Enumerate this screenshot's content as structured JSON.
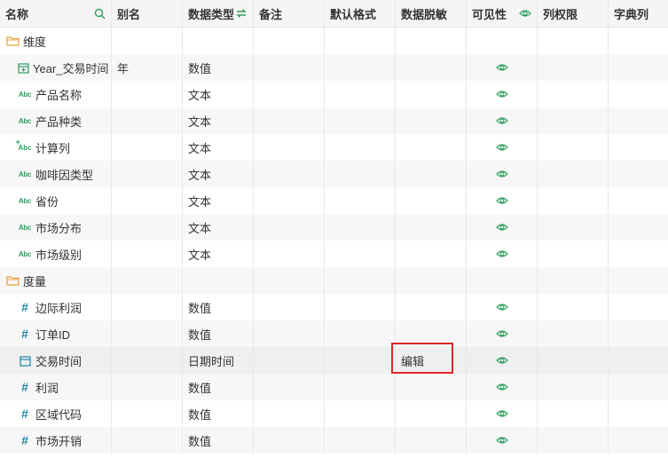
{
  "header": {
    "name": "名称",
    "alias": "别名",
    "data_type": "数据类型",
    "remark": "备注",
    "default_format": "默认格式",
    "data_masking": "数据脱敏",
    "visibility": "可见性",
    "column_permission": "列权限",
    "dictionary": "字典列"
  },
  "colors": {
    "accent_green": "#2e9e5b",
    "measure_blue": "#1d87a8",
    "folder_orange": "#e8a33d",
    "highlight_red": "#d9262b"
  },
  "rows": [
    {
      "kind": "folder",
      "icon": "folder-icon",
      "name": "维度",
      "alias": "",
      "type": "",
      "visible": false
    },
    {
      "kind": "field",
      "icon": "date-dim-icon",
      "name": "Year_交易时间",
      "alias": "年",
      "type": "数值",
      "visible": true
    },
    {
      "kind": "field",
      "icon": "text-abc-icon",
      "name": "产品名称",
      "alias": "",
      "type": "文本",
      "visible": true
    },
    {
      "kind": "field",
      "icon": "text-abc-icon",
      "name": "产品种类",
      "alias": "",
      "type": "文本",
      "visible": true
    },
    {
      "kind": "field",
      "icon": "calc-field-icon",
      "name": "计算列",
      "alias": "",
      "type": "文本",
      "visible": true
    },
    {
      "kind": "field",
      "icon": "text-abc-icon",
      "name": "咖啡因类型",
      "alias": "",
      "type": "文本",
      "visible": true
    },
    {
      "kind": "field",
      "icon": "text-abc-icon",
      "name": "省份",
      "alias": "",
      "type": "文本",
      "visible": true
    },
    {
      "kind": "field",
      "icon": "text-abc-icon",
      "name": "市场分布",
      "alias": "",
      "type": "文本",
      "visible": true
    },
    {
      "kind": "field",
      "icon": "text-abc-icon",
      "name": "市场级别",
      "alias": "",
      "type": "文本",
      "visible": true
    },
    {
      "kind": "folder",
      "icon": "folder-icon",
      "name": "度量",
      "alias": "",
      "type": "",
      "visible": false
    },
    {
      "kind": "field",
      "icon": "measure-hash-icon",
      "name": "边际利润",
      "alias": "",
      "type": "数值",
      "visible": true
    },
    {
      "kind": "field",
      "icon": "measure-hash-icon",
      "name": "订单ID",
      "alias": "",
      "type": "数值",
      "visible": true
    },
    {
      "kind": "field",
      "icon": "calendar-icon",
      "name": "交易时间",
      "alias": "",
      "type": "日期时间",
      "visible": true,
      "masking_action": "编辑",
      "selected": true
    },
    {
      "kind": "field",
      "icon": "measure-hash-icon",
      "name": "利润",
      "alias": "",
      "type": "数值",
      "visible": true
    },
    {
      "kind": "field",
      "icon": "measure-hash-icon",
      "name": "区域代码",
      "alias": "",
      "type": "数值",
      "visible": true
    },
    {
      "kind": "field",
      "icon": "measure-hash-icon",
      "name": "市场开销",
      "alias": "",
      "type": "数值",
      "visible": true
    }
  ]
}
